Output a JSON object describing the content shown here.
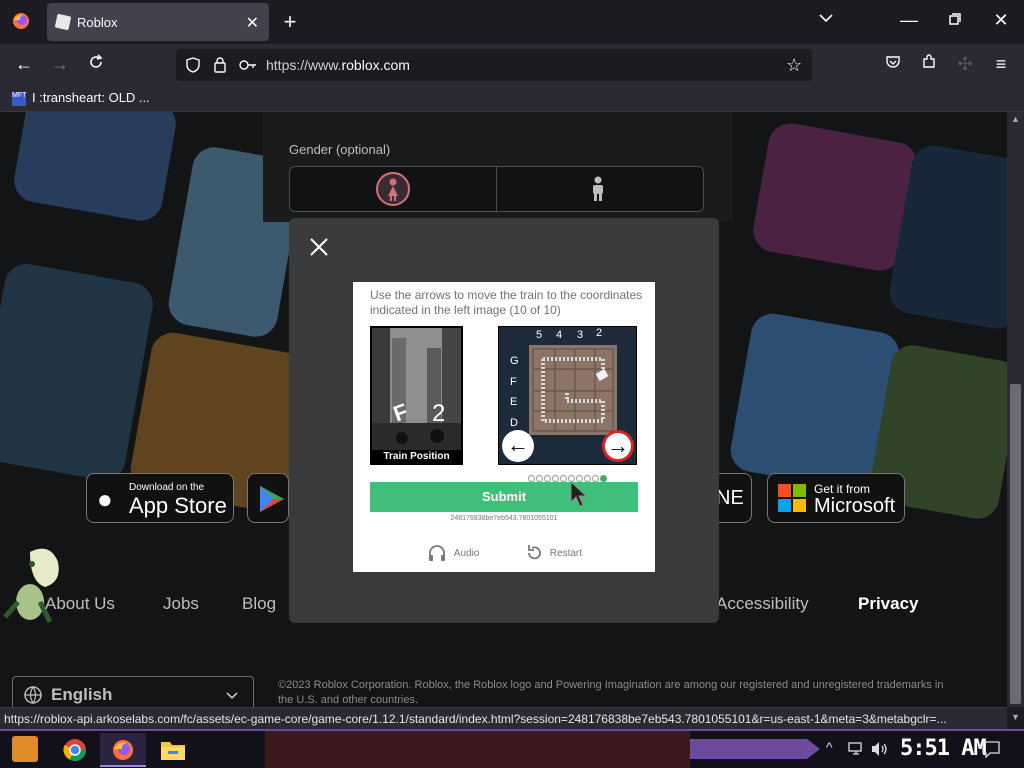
{
  "browser": {
    "tab_title": "Roblox",
    "url_prefix": "https://www.",
    "url_domain": "roblox.com",
    "url_suffix": ".com",
    "bookmark": "I :transheart: OLD ...",
    "bookmark_icon_text": "MFT"
  },
  "page": {
    "gender_label": "Gender (optional)",
    "stores": {
      "apple_small": "Download on the",
      "apple_big": "App Store",
      "ms_small": "Get it from",
      "ms_big": "Microsoft",
      "partial": "NE"
    },
    "footer_links": [
      "About Us",
      "Jobs",
      "Blog",
      "Accessibility",
      "Privacy"
    ],
    "language": "English",
    "copyright": "©2023 Roblox Corporation. Roblox, the Roblox logo and Powering Imagination are among our registered and unregistered trademarks in the U.S. and other countries."
  },
  "captcha": {
    "instruction": "Use the arrows to move the train to the coordinates indicated in the left image (10 of 10)",
    "left_caption": "Train Position",
    "left_letter": "F",
    "left_number": "2",
    "col_labels": [
      "5",
      "4",
      "3",
      "2"
    ],
    "row_labels": [
      "G",
      "F",
      "E",
      "D"
    ],
    "submit": "Submit",
    "session_id": "248176838be7eb543.7801055101",
    "audio": "Audio",
    "restart": "Restart",
    "progress_total": 10,
    "progress_current": 10
  },
  "statusbar": {
    "url": "https://roblox-api.arkoselabs.com/fc/assets/ec-game-core/game-core/1.12.1/standard/index.html?session=248176838be7eb543.7801055101&r=us-east-1&meta=3&metabgclr=..."
  },
  "taskbar": {
    "clock": "5:51 AM"
  },
  "colors": {
    "submit": "#3fbf7a",
    "progress_active": "#49a86a",
    "modal_bg": "#393b3d",
    "female_accent": "#d4717a"
  }
}
